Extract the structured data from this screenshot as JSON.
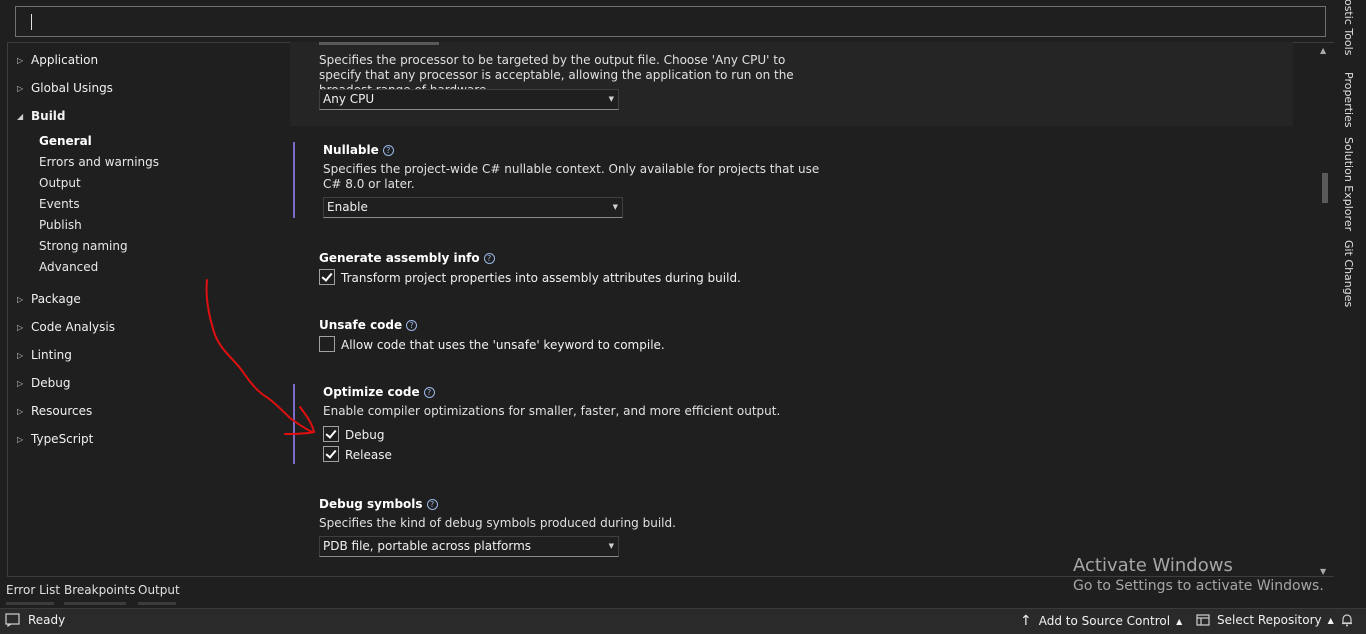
{
  "search": {
    "value": ""
  },
  "sidebar": {
    "groups": [
      {
        "label": "Application"
      },
      {
        "label": "Global Usings"
      },
      {
        "label": "Build"
      },
      {
        "label": "Package"
      },
      {
        "label": "Code Analysis"
      },
      {
        "label": "Linting"
      },
      {
        "label": "Debug"
      },
      {
        "label": "Resources"
      },
      {
        "label": "TypeScript"
      }
    ],
    "build_items": [
      {
        "label": "General"
      },
      {
        "label": "Errors and warnings"
      },
      {
        "label": "Output"
      },
      {
        "label": "Events"
      },
      {
        "label": "Publish"
      },
      {
        "label": "Strong naming"
      },
      {
        "label": "Advanced"
      }
    ],
    "selected": "General"
  },
  "settings": {
    "platform_target": {
      "description": "Specifies the processor to be targeted by the output file. Choose 'Any CPU' to specify that any processor is acceptable, allowing the application to run on the broadest range of hardware.",
      "value": "Any CPU"
    },
    "nullable": {
      "title": "Nullable",
      "description": "Specifies the project-wide C# nullable context. Only available for projects that use C# 8.0 or later.",
      "value": "Enable"
    },
    "generate_assembly_info": {
      "title": "Generate assembly info",
      "checkbox_label": "Transform project properties into assembly attributes during build.",
      "checked": true
    },
    "unsafe_code": {
      "title": "Unsafe code",
      "checkbox_label": "Allow code that uses the 'unsafe' keyword to compile.",
      "checked": false
    },
    "optimize_code": {
      "title": "Optimize code",
      "description": "Enable compiler optimizations for smaller, faster, and more efficient output.",
      "debug_label": "Debug",
      "debug_checked": true,
      "release_label": "Release",
      "release_checked": true
    },
    "debug_symbols": {
      "title": "Debug symbols",
      "description": "Specifies the kind of debug symbols produced during build.",
      "value": "PDB file, portable across platforms"
    },
    "help_glyph": "?"
  },
  "side_panel": {
    "tabs": [
      "nostic Tools",
      "Properties",
      "Solution Explorer",
      "Git Changes"
    ]
  },
  "bottom_tabs": [
    "Error List",
    "Breakpoints",
    "Output"
  ],
  "watermark": {
    "line1": "Activate Windows",
    "line2": "Go to Settings to activate Windows."
  },
  "status_bar": {
    "ready": "Ready",
    "source_control": "Add to Source Control",
    "repository": "Select Repository"
  },
  "colors": {
    "background": "#1f1f1f",
    "accent_bar": "#7a6cc6",
    "annotation": "#e01010",
    "help_icon": "#9ab7e6"
  }
}
